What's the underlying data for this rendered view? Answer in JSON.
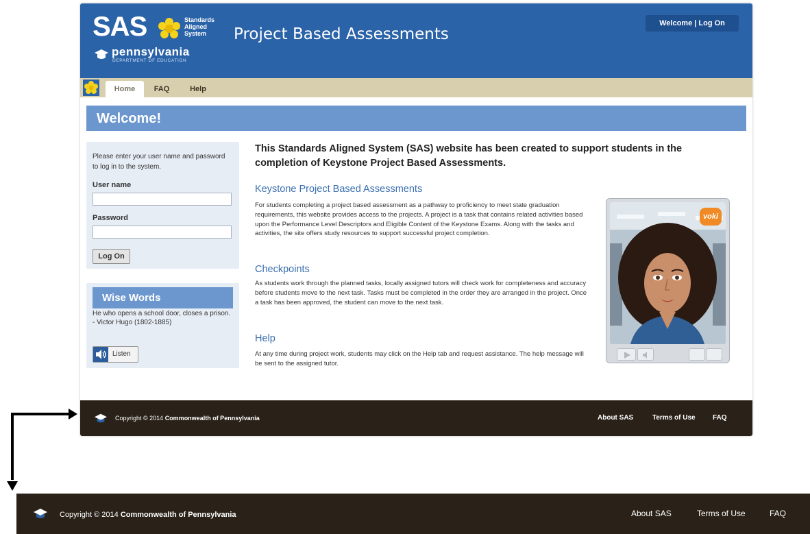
{
  "header": {
    "logo_sas": "SAS",
    "logo_sas_sub": [
      "Standards",
      "Aligned",
      "System"
    ],
    "logo_pa": "pennsylvania",
    "logo_pa_sub": "DEPARTMENT OF EDUCATION",
    "site_title": "Project Based Assessments",
    "welcome": "Welcome | Log On"
  },
  "nav": {
    "tabs": [
      {
        "label": "Home",
        "active": true
      },
      {
        "label": "FAQ",
        "active": false
      },
      {
        "label": "Help",
        "active": false
      }
    ]
  },
  "banner": {
    "title": "Welcome!"
  },
  "login": {
    "intro": "Please enter your user name and password to log in to the system.",
    "username_label": "User name",
    "username_value": "",
    "password_label": "Password",
    "password_value": "",
    "button": "Log On"
  },
  "wise_words": {
    "title": "Wise Words",
    "quote": "He who opens a school door, closes a prison.",
    "author": "- Victor Hugo (1802-1885)",
    "listen": "Listen"
  },
  "main": {
    "intro": "This Standards Aligned System (SAS) website has been created to support students in the completion of Keystone Project Based Assessments.",
    "sections": [
      {
        "title": "Keystone Project Based Assessments",
        "text": "For students completing a project based assessment as a pathway to proficiency to meet state graduation requirements, this website provides access to the projects. A project is a task that contains related activities based upon the Performance Level Descriptors and Eligible Content of the Keystone Exams. Along with the tasks and activities, the site offers study resources to support successful project completion."
      },
      {
        "title": "Checkpoints",
        "text": "As students work through the planned tasks, locally assigned tutors will check work for completeness and accuracy before students move to the next task. Tasks must be completed in the order they are arranged in the project. Once a task has been approved, the student can move to the next task."
      },
      {
        "title": "Help",
        "text": "At any time during project work, students may click on the Help tab and request assistance. The help message will be sent to the assigned tutor."
      }
    ],
    "avatar_badge": "voki"
  },
  "footer": {
    "copyright_prefix": "Copyright © 2014 ",
    "copyright_org": "Commonwealth of Pennsylvania",
    "links": [
      "About SAS",
      "Terms of Use",
      "FAQ"
    ]
  },
  "colors": {
    "header_blue": "#2b63a8",
    "nav_tan": "#d8cfae",
    "banner_blue": "#6c97ce",
    "panel_bg": "#e7edf5",
    "footer_dark": "#2a2218",
    "link_blue": "#3a6fb0"
  }
}
